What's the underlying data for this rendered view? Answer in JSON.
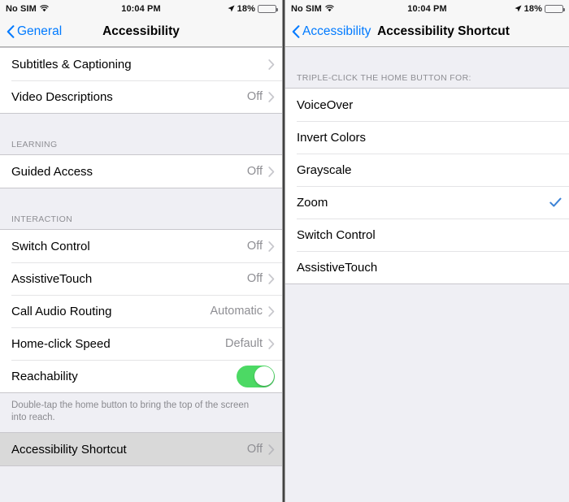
{
  "left": {
    "statusbar": {
      "carrier": "No SIM",
      "wifi_icon": "wifi-icon",
      "time": "10:04 PM",
      "location_icon": "location-arrow-icon",
      "battery_text": "18%",
      "battery_percent": 18,
      "battery_color": "#e8413a"
    },
    "navbar": {
      "back_icon": "chevron-left-icon",
      "back_label": "General",
      "title": "Accessibility",
      "accent_color": "#007aff"
    },
    "rows_top": [
      {
        "label": "Subtitles & Captioning",
        "value": "",
        "accessory": "chevron-right-icon"
      },
      {
        "label": "Video Descriptions",
        "value": "Off",
        "accessory": "chevron-right-icon"
      }
    ],
    "section_learning": {
      "header": "LEARNING",
      "rows": [
        {
          "label": "Guided Access",
          "value": "Off",
          "accessory": "chevron-right-icon"
        }
      ]
    },
    "section_interaction": {
      "header": "INTERACTION",
      "rows": [
        {
          "label": "Switch Control",
          "value": "Off",
          "accessory": "chevron-right-icon"
        },
        {
          "label": "AssistiveTouch",
          "value": "Off",
          "accessory": "chevron-right-icon"
        },
        {
          "label": "Call Audio Routing",
          "value": "Automatic",
          "accessory": "chevron-right-icon"
        },
        {
          "label": "Home-click Speed",
          "value": "Default",
          "accessory": "chevron-right-icon"
        }
      ],
      "toggle_row": {
        "label": "Reachability",
        "toggle_on": true,
        "toggle_color": "#4cd964"
      },
      "footer_note": "Double-tap the home button to bring the top of the screen into reach."
    },
    "shortcut_row": {
      "label": "Accessibility Shortcut",
      "value": "Off",
      "accessory": "chevron-right-icon",
      "pressed": true
    }
  },
  "right": {
    "statusbar": {
      "carrier": "No SIM",
      "wifi_icon": "wifi-icon",
      "time": "10:04 PM",
      "location_icon": "location-arrow-icon",
      "battery_text": "18%",
      "battery_percent": 18,
      "battery_color": "#e8413a"
    },
    "navbar": {
      "back_icon": "chevron-left-icon",
      "back_label": "Accessibility",
      "title": "Accessibility Shortcut",
      "accent_color": "#007aff"
    },
    "section": {
      "header": "TRIPLE-CLICK THE HOME BUTTON FOR:",
      "options": [
        {
          "label": "VoiceOver",
          "selected": false
        },
        {
          "label": "Invert Colors",
          "selected": false
        },
        {
          "label": "Grayscale",
          "selected": false
        },
        {
          "label": "Zoom",
          "selected": true
        },
        {
          "label": "Switch Control",
          "selected": false
        },
        {
          "label": "AssistiveTouch",
          "selected": false
        }
      ],
      "check_icon": "checkmark-icon",
      "check_color": "#007aff"
    }
  }
}
